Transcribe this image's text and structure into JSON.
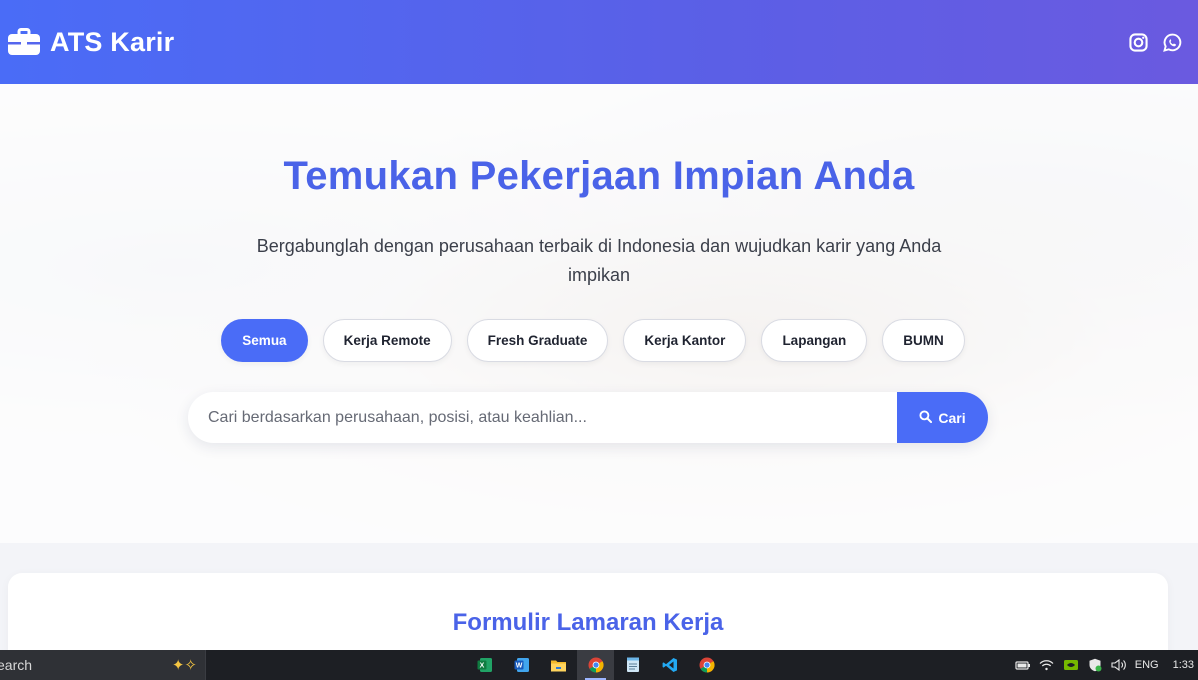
{
  "header": {
    "brand": "ATS Karir",
    "icons": [
      "briefcase-icon",
      "instagram-icon",
      "whatsapp-icon"
    ],
    "colors": {
      "gradient_start": "#4a6cf7",
      "gradient_end": "#6a5ae0"
    }
  },
  "hero": {
    "title": "Temukan Pekerjaan Impian Anda",
    "subtitle": "Bergabunglah dengan perusahaan terbaik di Indonesia dan wujudkan karir yang Anda impikan",
    "filters": [
      {
        "label": "Semua",
        "active": true
      },
      {
        "label": "Kerja Remote",
        "active": false
      },
      {
        "label": "Fresh Graduate",
        "active": false
      },
      {
        "label": "Kerja Kantor",
        "active": false
      },
      {
        "label": "Lapangan",
        "active": false
      },
      {
        "label": "BUMN",
        "active": false
      }
    ],
    "search": {
      "placeholder": "Cari berdasarkan perusahaan, posisi, atau keahlian...",
      "value": "",
      "button_label": "Cari"
    },
    "colors": {
      "accent": "#4a6cf7",
      "title": "#4a63e8"
    }
  },
  "form_section": {
    "title": "Formulir Lamaran Kerja"
  },
  "taskbar": {
    "search_text": "earch",
    "apps": [
      "excel-icon",
      "word-icon",
      "file-explorer-icon",
      "chrome-icon",
      "notepad-icon",
      "vscode-icon",
      "chrome-icon"
    ],
    "tray": {
      "language": "ENG",
      "time": "1:33"
    }
  }
}
